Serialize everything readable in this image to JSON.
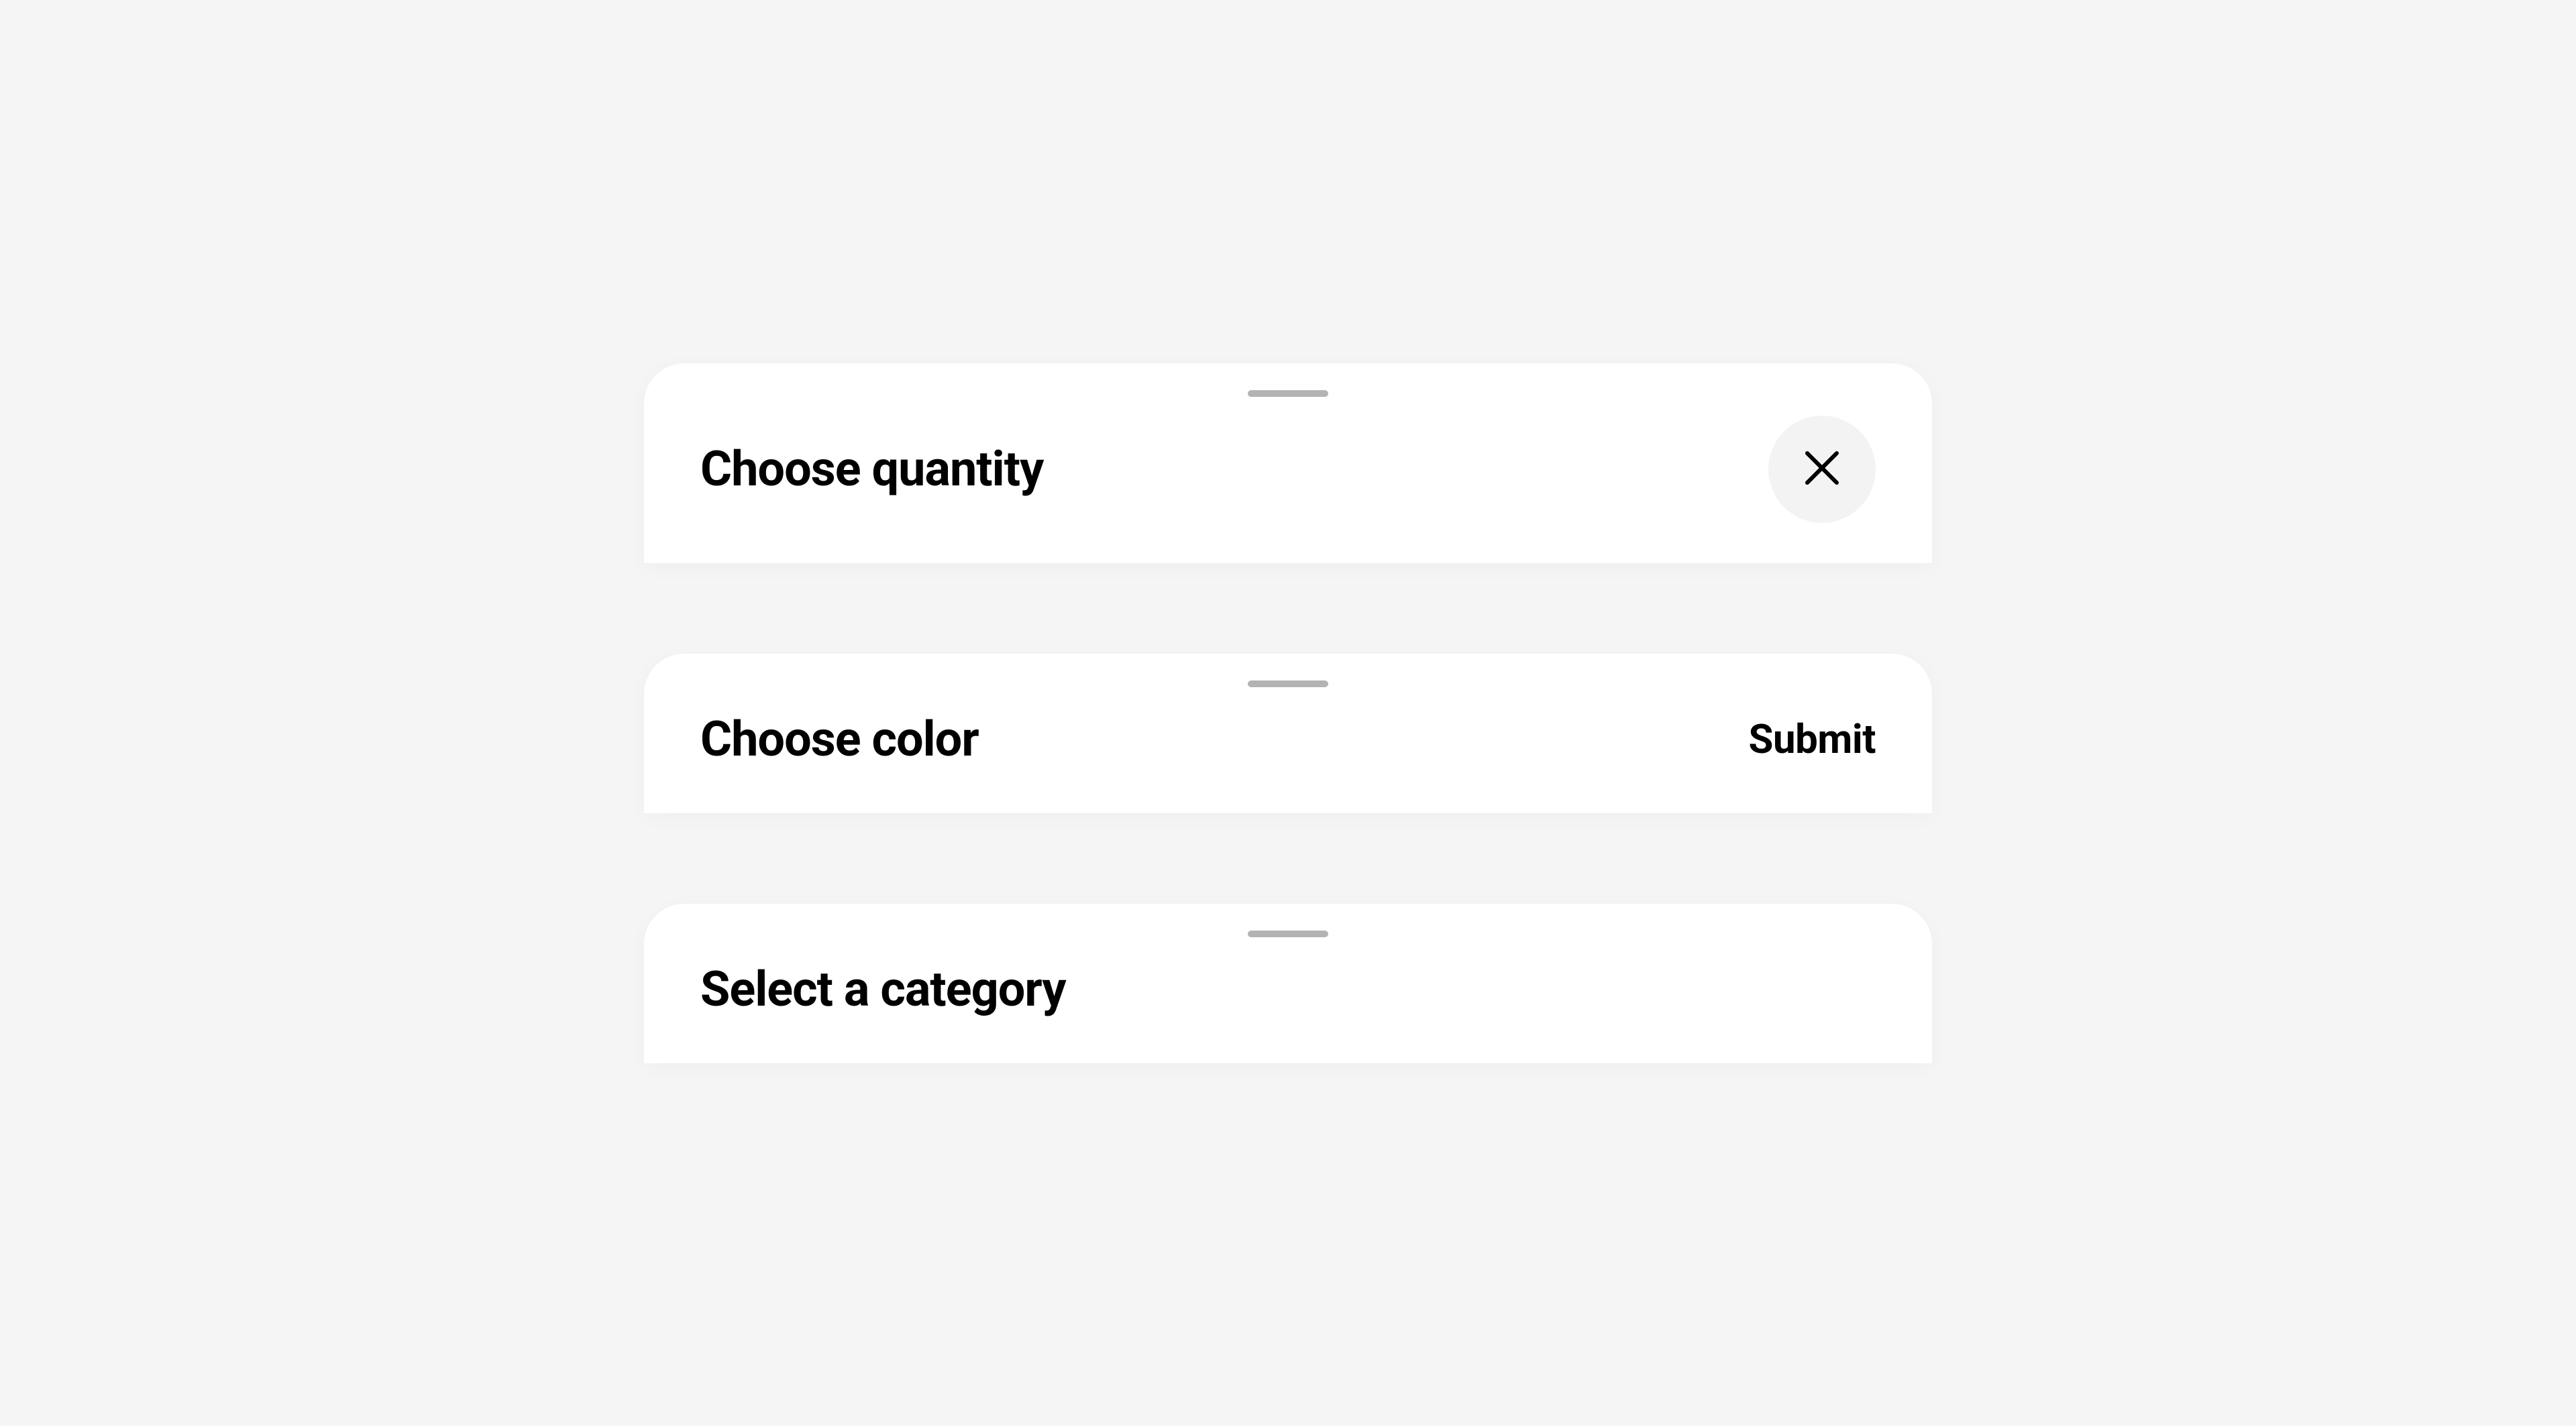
{
  "sheets": {
    "quantity": {
      "title": "Choose quantity"
    },
    "color": {
      "title": "Choose color",
      "action_label": "Submit"
    },
    "category": {
      "title": "Select a category"
    }
  }
}
